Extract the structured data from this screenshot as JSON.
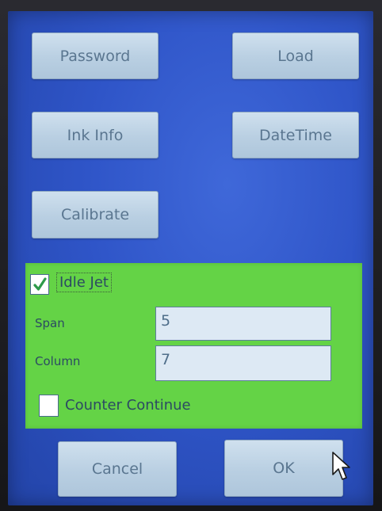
{
  "buttons": {
    "password": "Password",
    "load": "Load",
    "ink_info": "Ink Info",
    "datetime": "DateTime",
    "calibrate": "Calibrate",
    "cancel": "Cancel",
    "ok": "OK"
  },
  "idle_jet": {
    "label": "Idle Jet",
    "checked": true,
    "span_label": "Span",
    "span_value": "5",
    "column_label": "Column",
    "column_value": "7",
    "counter_continue_label": "Counter Continue",
    "counter_continue_checked": false
  },
  "colors": {
    "screen_blue": "#2f55c8",
    "panel_green": "#64d346",
    "button_face": "#c3d7e8",
    "checkmark_green": "#2e9a4a"
  },
  "icons": {
    "checkmark": "checkmark-icon",
    "cursor": "mouse-pointer-icon"
  }
}
